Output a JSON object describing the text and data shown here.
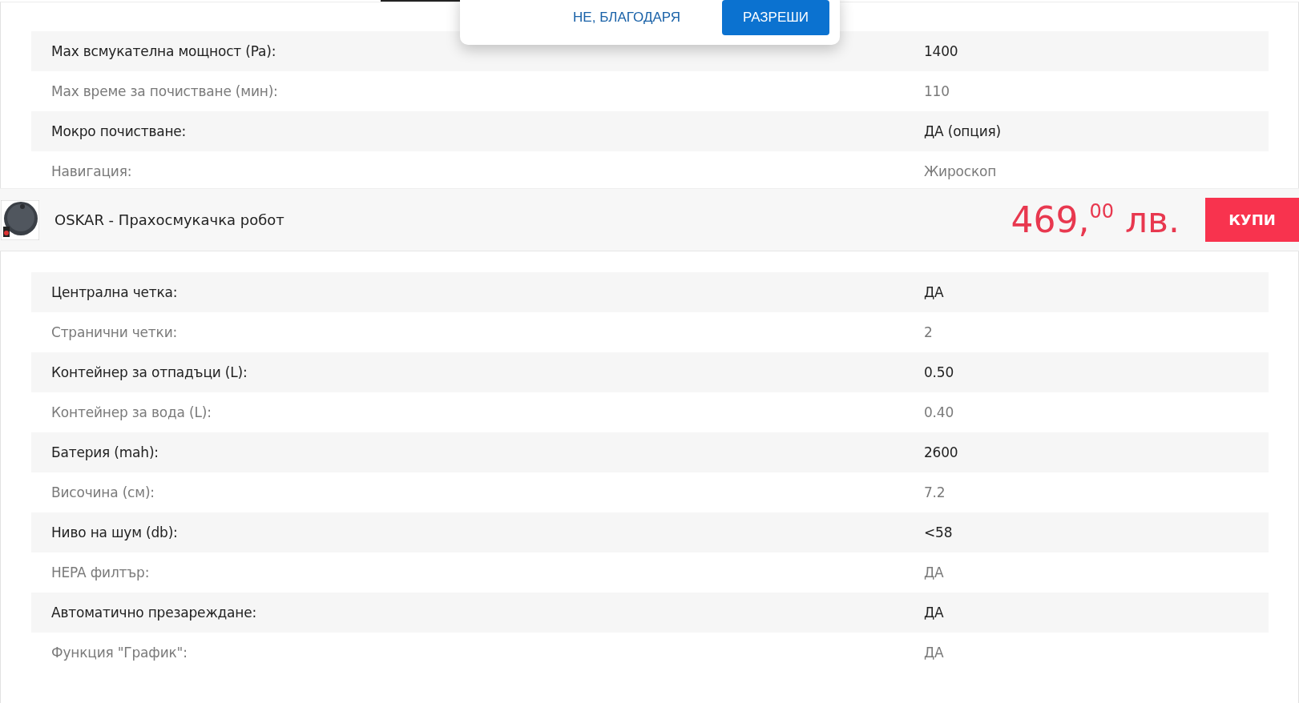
{
  "specs_above": [
    {
      "label": "Max всмукателна мощност (Pa):",
      "value": "1400"
    },
    {
      "label": "Max време за почистване (мин):",
      "value": "110"
    },
    {
      "label": "Мокро почистване:",
      "value": "ДА (опция)"
    },
    {
      "label": "Навигация:",
      "value": "Жироскоп"
    }
  ],
  "sticky_bar": {
    "title": "OSKAR - Прахосмукачка робот",
    "price": "469,$^{00}$ лв.",
    "buy_button": "КУПИ"
  },
  "specs_below": [
    {
      "label": "Централна четка:",
      "value": "ДА"
    },
    {
      "label": "Странични четки:",
      "value": "2"
    },
    {
      "label": "Контейнер за отпадъци (L):",
      "value": "0.50"
    },
    {
      "label": "Контейнер за вода (L):",
      "value": "0.40"
    },
    {
      "label": "Батерия (mah):",
      "value": "2600"
    },
    {
      "label": "Височина (см):",
      "value": "7.2"
    },
    {
      "label": "Ниво на шум (db):",
      "value": "<58"
    },
    {
      "label": "HEPA филтър:",
      "value": "ДА"
    },
    {
      "label": "Автоматично презареждане:",
      "value": "ДА"
    },
    {
      "label": "Функция \"График\":",
      "value": "ДА"
    }
  ],
  "permission_popup": {
    "buttons": [
      {
        "label": "НЕ, БЛАГОДАРЯ",
        "kind": "text"
      },
      {
        "label": "РАЗРЕШИ",
        "kind": "primary"
      }
    ]
  }
}
